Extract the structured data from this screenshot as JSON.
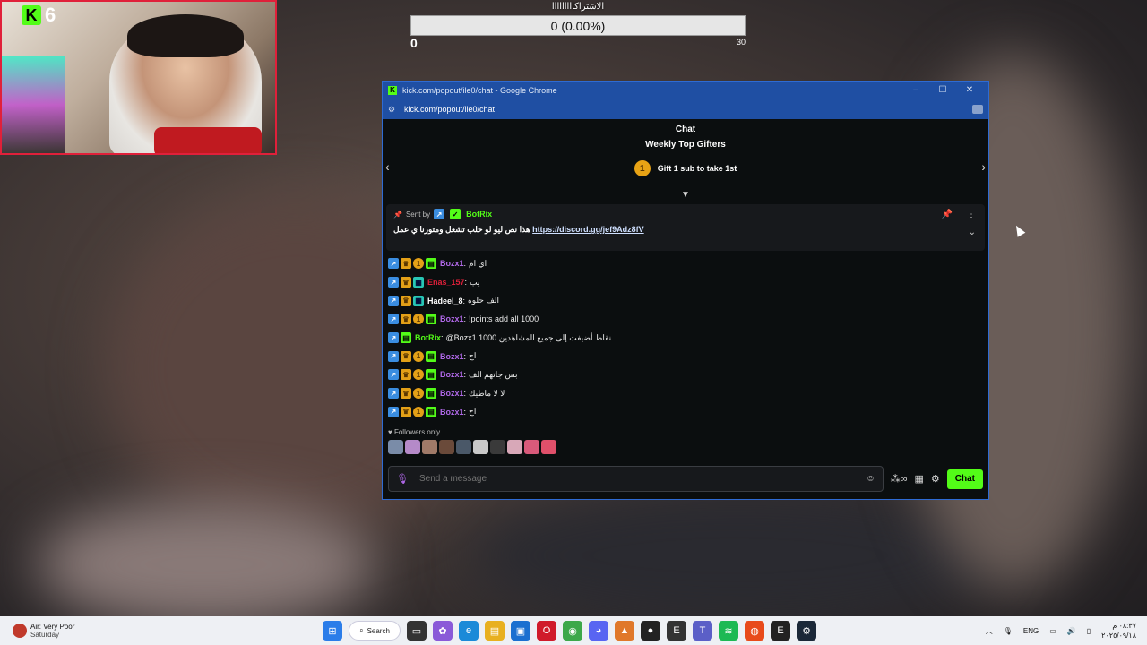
{
  "stream": {
    "viewer_count": "6"
  },
  "goal": {
    "title": "الاشتراكااااااااا",
    "progress_text": "0 (0.00%)",
    "progress_percent": 0,
    "min": "0",
    "max": "30"
  },
  "window": {
    "title": "kick.com/popout/ile0/chat - Google Chrome",
    "url": "kick.com/popout/ile0/chat",
    "minimize": "–",
    "maximize": "☐",
    "close": "✕"
  },
  "chat": {
    "header": "Chat",
    "gifters_title": "Weekly Top Gifters",
    "gifters_medal": "1",
    "gifters_text": "Gift 1 sub to take 1st",
    "pinned": {
      "sent_by": "Sent by",
      "user": "BotRix",
      "text": "هذا نص ليو لو حلب تشغل ومتورنا ي عمل",
      "link": "https://discord.gg/jef9Adz8fV"
    },
    "messages": [
      {
        "user": "Bozx1",
        "color": "#b068e8",
        "text": "اي ام",
        "badges": [
          "blue",
          "gold",
          "coin",
          "green"
        ]
      },
      {
        "user": "Enas_157",
        "color": "#e0203a",
        "text": "يب",
        "badges": [
          "blue",
          "gold",
          "teal"
        ]
      },
      {
        "user": "Hadeel_8",
        "color": "#ffffff",
        "text": "الف حلوه",
        "badges": [
          "blue",
          "gold",
          "teal"
        ]
      },
      {
        "user": "Bozx1",
        "color": "#b068e8",
        "text": "!points add all 1000",
        "badges": [
          "blue",
          "gold",
          "coin",
          "green"
        ]
      },
      {
        "user": "BotRix",
        "color": "#53fc18",
        "text": "@Bozx1 1000 نقاط أضيفت إلى جميع المشاهدين.",
        "badges": [
          "blue",
          "green"
        ]
      },
      {
        "user": "Bozx1",
        "color": "#b068e8",
        "text": "اح",
        "badges": [
          "blue",
          "gold",
          "coin",
          "green"
        ]
      },
      {
        "user": "Bozx1",
        "color": "#b068e8",
        "text": "بس جاتهم الف",
        "badges": [
          "blue",
          "gold",
          "coin",
          "green"
        ]
      },
      {
        "user": "Bozx1",
        "color": "#b068e8",
        "text": "لا لا ماطيك",
        "badges": [
          "blue",
          "gold",
          "coin",
          "green"
        ]
      },
      {
        "user": "Bozx1",
        "color": "#b068e8",
        "text": "اح",
        "badges": [
          "blue",
          "gold",
          "coin",
          "green"
        ]
      }
    ],
    "followers_only": "♥ Followers only",
    "input_placeholder": "Send a message",
    "chat_button": "Chat"
  },
  "taskbar": {
    "weather_title": "Air: Very Poor",
    "weather_sub": "Saturday",
    "search_label": "Search",
    "lang": "ENG",
    "time": "٠٨:٣٧ م",
    "date": "٢٠٢٥/٠٩/١٨"
  }
}
